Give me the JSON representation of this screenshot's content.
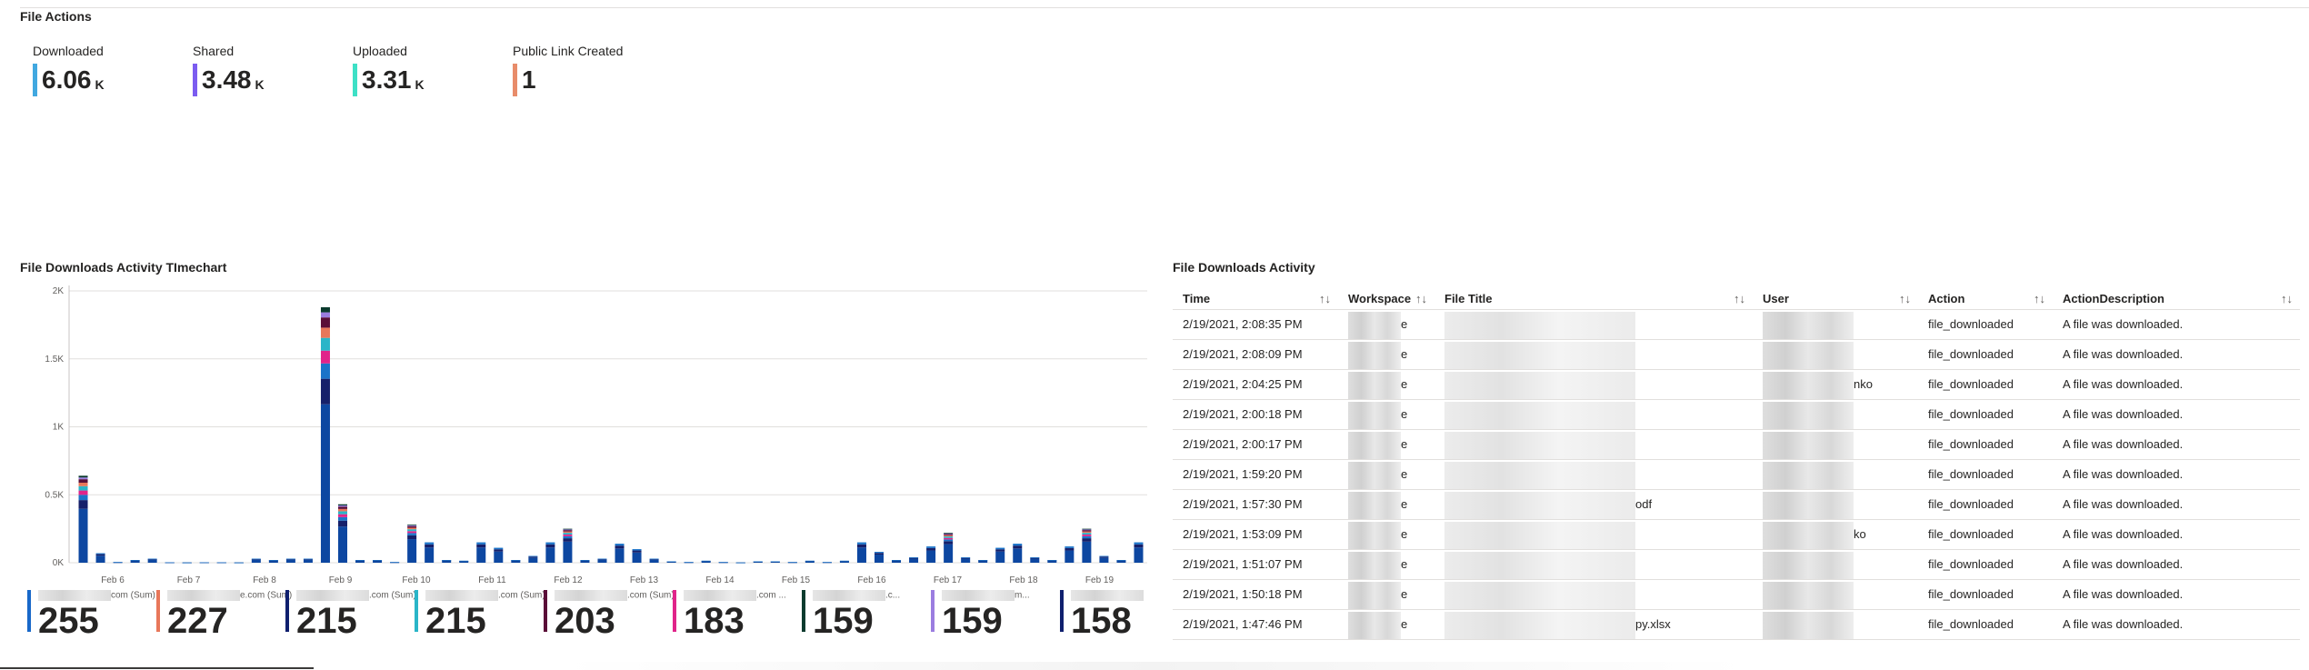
{
  "file_actions": {
    "title": "File Actions",
    "kpis": [
      {
        "label": "Downloaded",
        "value": "6.06",
        "unit": "K",
        "color": "#41a8e0"
      },
      {
        "label": "Shared",
        "value": "3.48",
        "unit": "K",
        "color": "#7b5cf0"
      },
      {
        "label": "Uploaded",
        "value": "3.31",
        "unit": "K",
        "color": "#3ee0c6"
      },
      {
        "label": "Public Link Created",
        "value": "1",
        "unit": "",
        "color": "#e88c6a"
      }
    ]
  },
  "timechart": {
    "title": "File Downloads Activity TImechart",
    "legend": [
      {
        "name_suffix": "com (Sum)",
        "value": "255",
        "color": "#1868c9"
      },
      {
        "name_suffix": "e.com (Sum)",
        "value": "227",
        "color": "#e8775a"
      },
      {
        "name_suffix": ".com (Sum)",
        "value": "215",
        "color": "#0f1f6e"
      },
      {
        "name_suffix": ".com (Sum)",
        "value": "215",
        "color": "#2ab5c8"
      },
      {
        "name_suffix": ".com (Sum)",
        "value": "203",
        "color": "#5a0e38"
      },
      {
        "name_suffix": ".com ...",
        "value": "183",
        "color": "#e0248a"
      },
      {
        "name_suffix": ".c...",
        "value": "159",
        "color": "#0b3b2e"
      },
      {
        "name_suffix": "m...",
        "value": "159",
        "color": "#9b7de0"
      },
      {
        "name_suffix": "",
        "value": "158",
        "color": "#0f1f6e"
      }
    ]
  },
  "chart_data": {
    "type": "bar",
    "stacked": true,
    "title": "File Downloads Activity TImechart",
    "y_ticks": [
      "0K",
      "0.5K",
      "1K",
      "1.5K",
      "2K"
    ],
    "ylim": [
      0,
      2000
    ],
    "x_tick_labels": [
      "Feb 6",
      "Feb 7",
      "Feb 8",
      "Feb 9",
      "Feb 10",
      "Feb 11",
      "Feb 12",
      "Feb 13",
      "Feb 14",
      "Feb 15",
      "Feb 16",
      "Feb 17",
      "Feb 18",
      "Feb 19"
    ],
    "totals": [
      640,
      70,
      5,
      20,
      30,
      3,
      2,
      3,
      3,
      2,
      30,
      20,
      30,
      30,
      1880,
      430,
      20,
      20,
      5,
      280,
      150,
      20,
      15,
      150,
      110,
      20,
      50,
      150,
      250,
      20,
      30,
      140,
      100,
      30,
      10,
      5,
      15,
      5,
      2,
      10,
      10,
      5,
      15,
      5,
      15,
      150,
      80,
      20,
      40,
      120,
      220,
      40,
      20,
      110,
      140,
      40,
      20,
      120,
      250,
      50,
      20,
      150
    ],
    "segment_colors": [
      "#0d47a1",
      "#16206a",
      "#1a73c9",
      "#e0248a",
      "#2ab5c8",
      "#e8775a",
      "#5a0e38",
      "#9b7de0",
      "#0b3b2e"
    ],
    "grid": true
  },
  "table": {
    "title": "File Downloads Activity",
    "columns": [
      "Time",
      "Workspace",
      "File Title",
      "User",
      "Action",
      "ActionDescription"
    ],
    "rows": [
      {
        "time": "2/19/2021, 2:08:35 PM",
        "workspace": "e",
        "file": "",
        "user": "",
        "action": "file_downloaded",
        "desc": "A file was downloaded."
      },
      {
        "time": "2/19/2021, 2:08:09 PM",
        "workspace": "e",
        "file": "",
        "user": "",
        "action": "file_downloaded",
        "desc": "A file was downloaded."
      },
      {
        "time": "2/19/2021, 2:04:25 PM",
        "workspace": "e",
        "file": "",
        "user": "nko",
        "action": "file_downloaded",
        "desc": "A file was downloaded."
      },
      {
        "time": "2/19/2021, 2:00:18 PM",
        "workspace": "e",
        "file": "",
        "user": "",
        "action": "file_downloaded",
        "desc": "A file was downloaded."
      },
      {
        "time": "2/19/2021, 2:00:17 PM",
        "workspace": "e",
        "file": "",
        "user": "",
        "action": "file_downloaded",
        "desc": "A file was downloaded."
      },
      {
        "time": "2/19/2021, 1:59:20 PM",
        "workspace": "e",
        "file": "",
        "user": "",
        "action": "file_downloaded",
        "desc": "A file was downloaded."
      },
      {
        "time": "2/19/2021, 1:57:30 PM",
        "workspace": "e",
        "file": "odf",
        "user": "",
        "action": "file_downloaded",
        "desc": "A file was downloaded."
      },
      {
        "time": "2/19/2021, 1:53:09 PM",
        "workspace": "e",
        "file": "",
        "user": "ko",
        "action": "file_downloaded",
        "desc": "A file was downloaded."
      },
      {
        "time": "2/19/2021, 1:51:07 PM",
        "workspace": "e",
        "file": "",
        "user": "",
        "action": "file_downloaded",
        "desc": "A file was downloaded."
      },
      {
        "time": "2/19/2021, 1:50:18 PM",
        "workspace": "e",
        "file": "",
        "user": "",
        "action": "file_downloaded",
        "desc": "A file was downloaded."
      },
      {
        "time": "2/19/2021, 1:47:46 PM",
        "workspace": "e",
        "file": "py.xlsx",
        "user": "",
        "action": "file_downloaded",
        "desc": "A file was downloaded."
      }
    ]
  }
}
